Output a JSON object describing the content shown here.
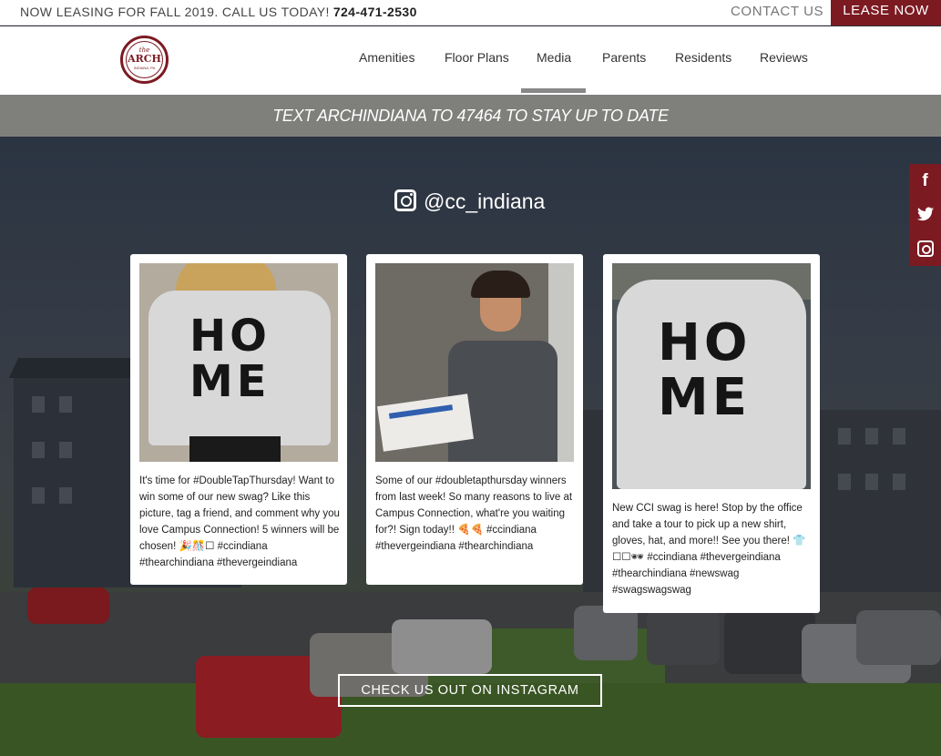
{
  "topbar": {
    "announcement": "NOW LEASING FOR FALL 2019. CALL US TODAY!",
    "phone": "724-471-2530",
    "contact_label": "CONTACT US",
    "lease_label": "LEASE NOW"
  },
  "logo": {
    "the": "the",
    "name": "ARCH",
    "place": "INDIANA, PA"
  },
  "nav": {
    "items": [
      {
        "label": "Amenities"
      },
      {
        "label": "Floor Plans"
      },
      {
        "label": "Media",
        "active": true
      },
      {
        "label": "Parents"
      },
      {
        "label": "Residents"
      },
      {
        "label": "Reviews"
      }
    ]
  },
  "banner": {
    "text": "TEXT ARCHINDIANA TO 47464 TO STAY UP TO DATE"
  },
  "instagram": {
    "handle": "@cc_indiana",
    "posts": [
      {
        "caption": "It's time for #DoubleTapThursday! Want to win some of our new swag? Like this picture, tag a friend, and comment why you love Campus Connection! 5 winners will be chosen! 🎉🎊☐ #ccindiana #thearchindiana #thevergeindiana",
        "image": "woman in HOME sweatshirt"
      },
      {
        "caption": "Some of our #doubletapthursday winners from last week! So many reasons to live at Campus Connection, what're you waiting for?! Sign today!! 🍕🍕 #ccindiana #thevergeindiana #thearchindiana",
        "image": "woman holding pizza boxes"
      },
      {
        "caption": "New CCI swag is here! Stop by the office and take a tour to pick up a new shirt, gloves, hat, and more!! See you there! 👕☐☐🕶 #ccindiana #thevergeindiana #thearchindiana #newswag #swagswagswag",
        "image": "man in HOME sweatshirt"
      }
    ],
    "shirt_text_top": "HO",
    "shirt_text_bottom": "ME",
    "cta_label": "CHECK US OUT ON INSTAGRAM"
  },
  "social": {
    "facebook": "f",
    "twitter": "t",
    "instagram_icon": "instagram-icon"
  },
  "colors": {
    "brand": "#7c1a22",
    "band": "#7f807c"
  }
}
